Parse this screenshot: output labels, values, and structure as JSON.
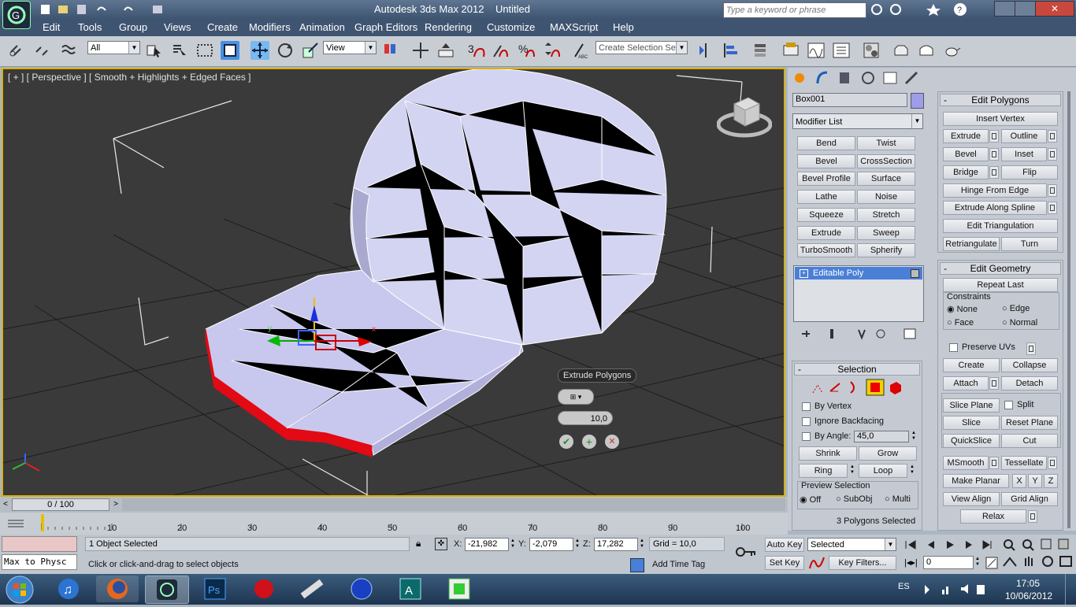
{
  "window": {
    "app_title": "Autodesk 3ds Max  2012",
    "doc_title": "Untitled",
    "search_placeholder": "Type a keyword or phrase"
  },
  "menu": [
    "Edit",
    "Tools",
    "Group",
    "Views",
    "Create",
    "Modifiers",
    "Animation",
    "Graph Editors",
    "Rendering",
    "Customize",
    "MAXScript",
    "Help"
  ],
  "toolbar": {
    "filter_value": "All",
    "refcoord_value": "View",
    "selection_set_value": "Create Selection Se",
    "snap_labels": [
      "3",
      "%"
    ]
  },
  "viewport": {
    "label": "[ + ] [ Perspective ] [ Smooth + Highlights + Edged Faces ]",
    "caddy_title": "Extrude Polygons",
    "caddy_value": "10,0",
    "axis_x": "x",
    "axis_y": "y"
  },
  "command_panel": {
    "object_name": "Box001",
    "modifier_list_label": "Modifier List",
    "modifier_buttons": [
      "Bend",
      "Twist",
      "Bevel",
      "CrossSection",
      "Bevel Profile",
      "Surface",
      "Lathe",
      "Noise",
      "Squeeze",
      "Stretch",
      "Extrude",
      "Sweep",
      "TurboSmooth",
      "Spherify"
    ],
    "stack_item": "Editable Poly",
    "selection": {
      "title": "Selection",
      "by_vertex": "By Vertex",
      "ignore_backfacing": "Ignore Backfacing",
      "by_angle": "By Angle:",
      "angle_value": "45,0",
      "shrink": "Shrink",
      "grow": "Grow",
      "ring": "Ring",
      "loop": "Loop",
      "preview_title": "Preview Selection",
      "preview_off": "Off",
      "preview_subobj": "SubObj",
      "preview_multi": "Multi",
      "status": "3 Polygons Selected"
    },
    "edit_polygons": {
      "title": "Edit Polygons",
      "insert_vertex": "Insert Vertex",
      "extrude": "Extrude",
      "outline": "Outline",
      "bevel": "Bevel",
      "inset": "Inset",
      "bridge": "Bridge",
      "flip": "Flip",
      "hinge": "Hinge From Edge",
      "extrude_spline": "Extrude Along Spline",
      "edit_tri": "Edit Triangulation",
      "retri": "Retriangulate",
      "turn": "Turn"
    },
    "edit_geometry": {
      "title": "Edit Geometry",
      "repeat_last": "Repeat Last",
      "constraints": "Constraints",
      "none": "None",
      "edge": "Edge",
      "face": "Face",
      "normal": "Normal",
      "preserve_uvs": "Preserve UVs",
      "create": "Create",
      "collapse": "Collapse",
      "attach": "Attach",
      "detach": "Detach",
      "slice_plane": "Slice Plane",
      "split": "Split",
      "slice": "Slice",
      "reset_plane": "Reset Plane",
      "quickslice": "QuickSlice",
      "cut": "Cut",
      "msmooth": "MSmooth",
      "tessellate": "Tessellate",
      "make_planar": "Make Planar",
      "x": "X",
      "y": "Y",
      "z": "Z",
      "view_align": "View Align",
      "grid_align": "Grid Align",
      "relax": "Relax"
    }
  },
  "timeline": {
    "frame_counter": "0 / 100",
    "ticks": [
      "10",
      "20",
      "30",
      "40",
      "50",
      "60",
      "70",
      "80",
      "90",
      "100"
    ]
  },
  "status": {
    "maxscript_text": "Max to Physc",
    "objects_selected": "1 Object Selected",
    "prompt": "Click or click-and-drag to select objects",
    "x_label": "X:",
    "x_value": "-21,982",
    "y_label": "Y:",
    "y_value": "-2,079",
    "z_label": "Z:",
    "z_value": "17,282",
    "grid": "Grid = 10,0",
    "add_time_tag": "Add Time Tag",
    "auto_key": "Auto Key",
    "set_key": "Set Key",
    "selected_value": "Selected",
    "key_filters": "Key Filters...",
    "frame_value": "0"
  },
  "taskbar": {
    "language": "ES",
    "time": "17:05",
    "date": "10/06/2012"
  },
  "colors": {
    "selection_red": "#e8000d",
    "mesh_face": "#c9c9f0",
    "viewport_bg": "#3a3a3a",
    "active_border": "#d9b000"
  }
}
